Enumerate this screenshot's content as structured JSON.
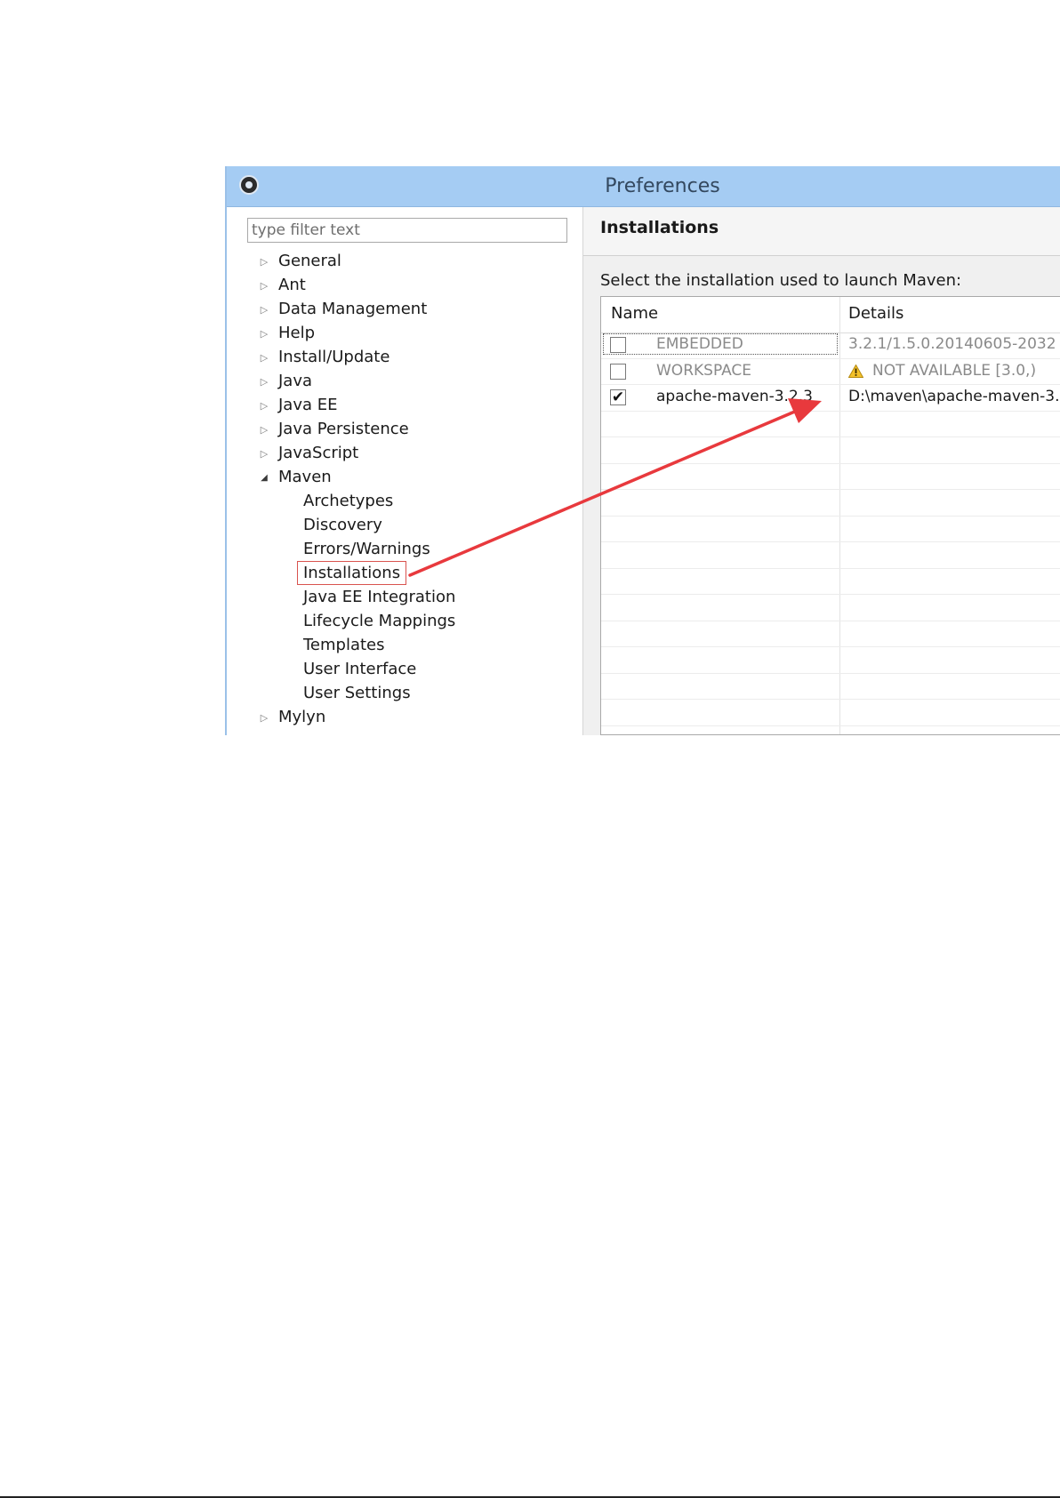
{
  "window": {
    "title": "Preferences"
  },
  "filter": {
    "placeholder": "type filter text"
  },
  "tree": {
    "items": [
      {
        "label": "General",
        "expanded": false
      },
      {
        "label": "Ant",
        "expanded": false
      },
      {
        "label": "Data Management",
        "expanded": false
      },
      {
        "label": "Help",
        "expanded": false
      },
      {
        "label": "Install/Update",
        "expanded": false
      },
      {
        "label": "Java",
        "expanded": false
      },
      {
        "label": "Java EE",
        "expanded": false
      },
      {
        "label": "Java Persistence",
        "expanded": false
      },
      {
        "label": "JavaScript",
        "expanded": false
      },
      {
        "label": "Maven",
        "expanded": true
      },
      {
        "label": "Mylyn",
        "expanded": false
      }
    ],
    "maven_children": [
      "Archetypes",
      "Discovery",
      "Errors/Warnings",
      "Installations",
      "Java EE Integration",
      "Lifecycle Mappings",
      "Templates",
      "User Interface",
      "User Settings"
    ],
    "selected": "Installations"
  },
  "page": {
    "title": "Installations",
    "instruction": "Select the installation used to launch Maven:"
  },
  "table": {
    "columns": [
      "Name",
      "Details"
    ],
    "rows": [
      {
        "name": "EMBEDDED",
        "details": "3.2.1/1.5.0.20140605-2032",
        "checked": false,
        "enabled": false
      },
      {
        "name": "WORKSPACE",
        "details": "NOT AVAILABLE [3.0,)",
        "checked": false,
        "enabled": false,
        "warning": true
      },
      {
        "name": "apache-maven-3.2.3",
        "details": "D:\\maven\\apache-maven-3.",
        "checked": true,
        "enabled": true
      }
    ]
  },
  "colors": {
    "titlebar": "#a5ccf3",
    "annotation_red": "#e8393d"
  },
  "icons": {
    "app": "eclipse-gear-icon",
    "collapsed": "triangle-right-icon",
    "expanded": "triangle-down-icon",
    "check": "check-icon",
    "warning": "warning-icon"
  }
}
